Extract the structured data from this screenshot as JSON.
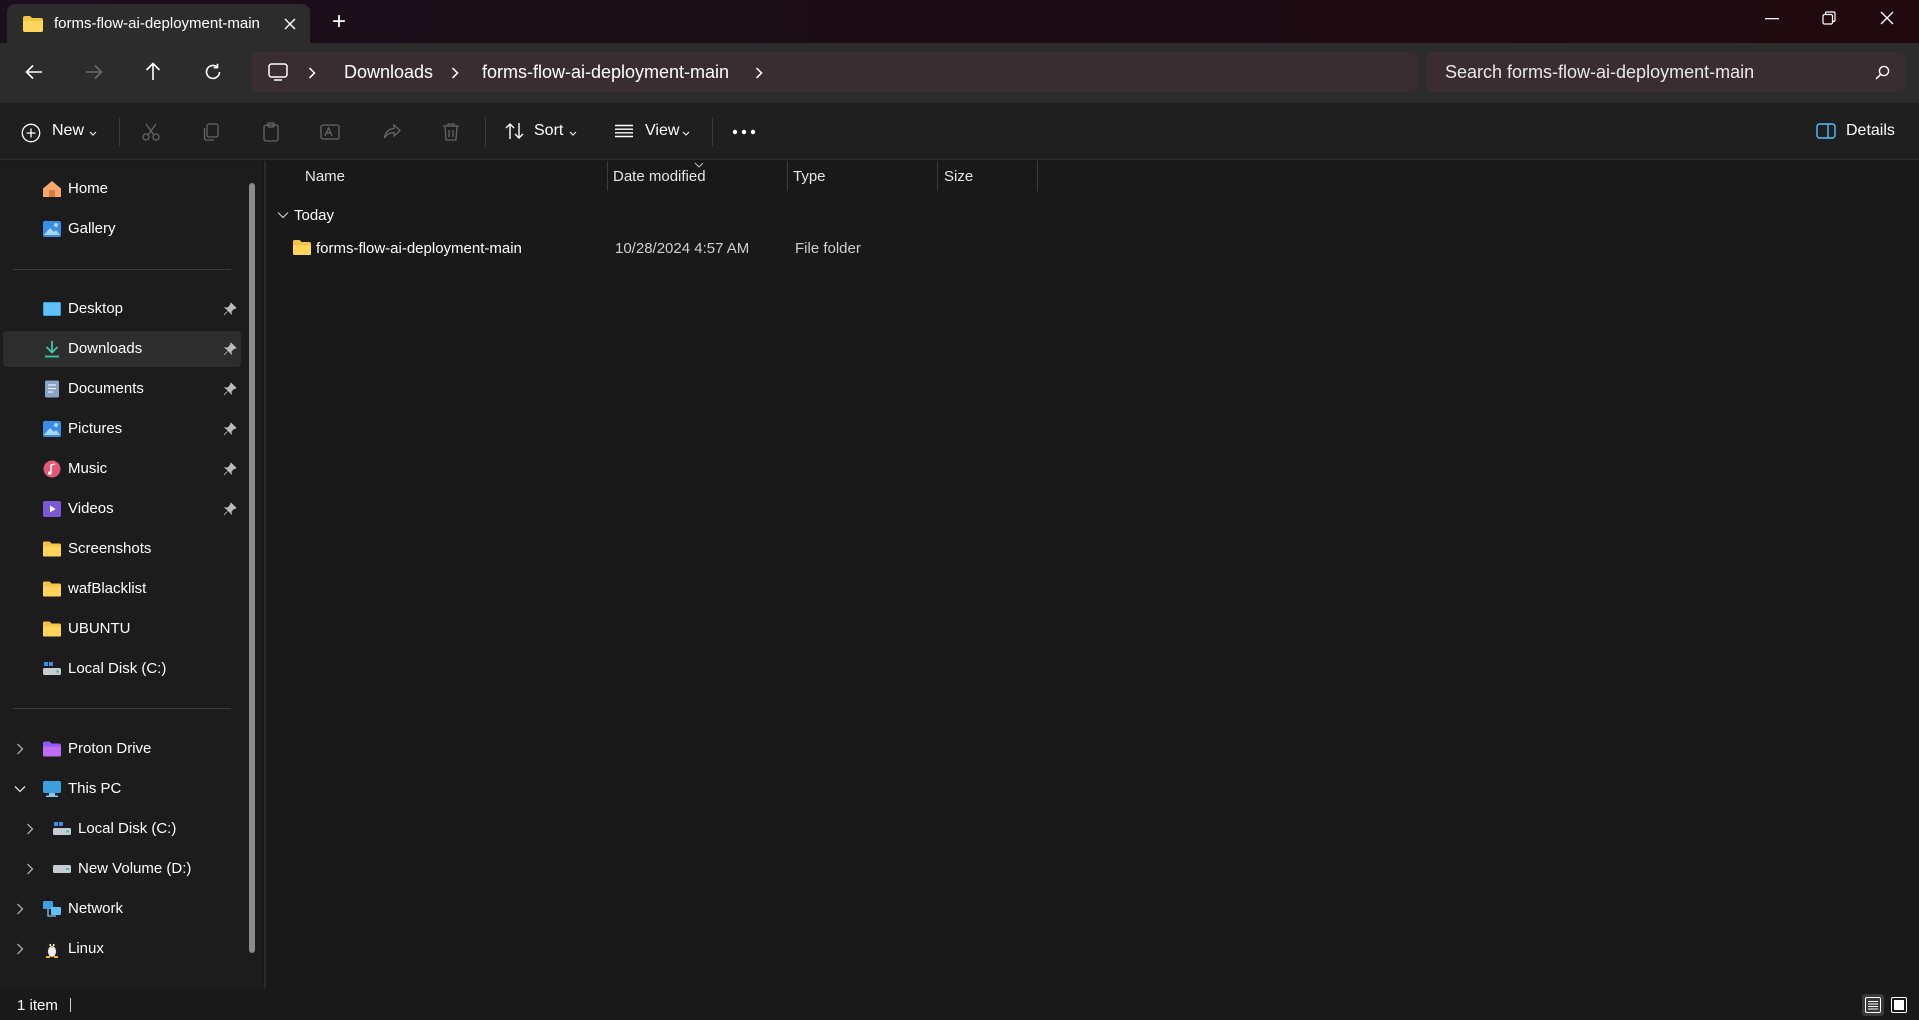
{
  "window": {
    "tab_title": "forms-flow-ai-deployment-main",
    "new_tab_symbol": "+"
  },
  "nav": {
    "breadcrumbs": [
      "Downloads",
      "forms-flow-ai-deployment-main"
    ],
    "search_placeholder": "Search forms-flow-ai-deployment-main"
  },
  "toolbar": {
    "new_label": "New",
    "sort_label": "Sort",
    "view_label": "View",
    "details_label": "Details"
  },
  "sidebar": {
    "top": [
      {
        "label": "Home"
      },
      {
        "label": "Gallery"
      }
    ],
    "pinned": [
      {
        "label": "Desktop"
      },
      {
        "label": "Downloads"
      },
      {
        "label": "Documents"
      },
      {
        "label": "Pictures"
      },
      {
        "label": "Music"
      },
      {
        "label": "Videos"
      },
      {
        "label": "Screenshots"
      },
      {
        "label": "wafBlacklist"
      },
      {
        "label": "UBUNTU"
      },
      {
        "label": "Local Disk (C:)"
      }
    ],
    "tree": [
      {
        "label": "Proton Drive"
      },
      {
        "label": "This PC"
      },
      {
        "label": "Local Disk (C:)"
      },
      {
        "label": "New Volume (D:)"
      },
      {
        "label": "Network"
      },
      {
        "label": "Linux"
      }
    ],
    "selected": "Downloads"
  },
  "columns": [
    "Name",
    "Date modified",
    "Type",
    "Size"
  ],
  "group": {
    "label": "Today"
  },
  "files": [
    {
      "name": "forms-flow-ai-deployment-main",
      "date_modified": "10/28/2024 4:57 AM",
      "type": "File folder",
      "size": ""
    }
  ],
  "status": {
    "item_count": "1 item"
  }
}
